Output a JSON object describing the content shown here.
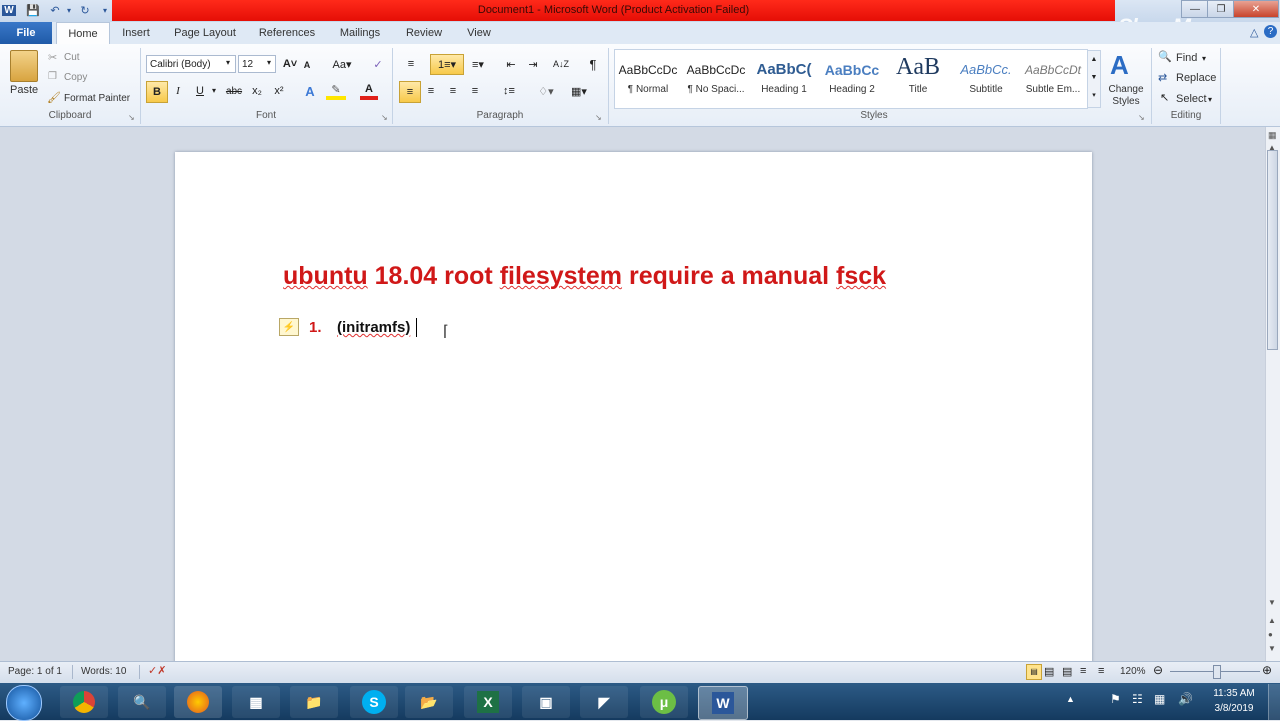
{
  "window": {
    "title": "Document1  -  Microsoft Word (Product Activation Failed)",
    "watermark": "ShowMore"
  },
  "tabs": [
    "File",
    "Home",
    "Insert",
    "Page Layout",
    "References",
    "Mailings",
    "Review",
    "View"
  ],
  "clipboard": {
    "paste": "Paste",
    "cut": "Cut",
    "copy": "Copy",
    "format_painter": "Format Painter",
    "group": "Clipboard"
  },
  "font": {
    "name": "Calibri (Body)",
    "size": "12",
    "group": "Font"
  },
  "paragraph": {
    "group": "Paragraph"
  },
  "styles": {
    "group": "Styles",
    "change_styles": "Change Styles",
    "items": [
      {
        "sample": "AaBbCcDc",
        "name": "¶ Normal"
      },
      {
        "sample": "AaBbCcDc",
        "name": "¶ No Spaci..."
      },
      {
        "sample": "AaBbC(",
        "name": "Heading 1"
      },
      {
        "sample": "AaBbCc",
        "name": "Heading 2"
      },
      {
        "sample": "AaB",
        "name": "Title"
      },
      {
        "sample": "AaBbCc.",
        "name": "Subtitle"
      },
      {
        "sample": "AaBbCcDt",
        "name": "Subtle Em..."
      }
    ]
  },
  "editing": {
    "group": "Editing",
    "find": "Find",
    "replace": "Replace",
    "select": "Select"
  },
  "document": {
    "title_words": [
      "ubuntu",
      "18.04",
      "root",
      "filesystem",
      "require",
      "a",
      "manual",
      "fsck"
    ],
    "list_number": "1.",
    "list_text": "(initramfs)"
  },
  "status": {
    "page": "Page: 1 of 1",
    "words": "Words: 10",
    "zoom": "120%"
  },
  "clock": {
    "time": "11:35 AM",
    "date": "3/8/2019"
  },
  "colors": {
    "title_bar_red": "#e50e06",
    "heading_red": "#d01818",
    "file_tab_blue": "#2b62b0"
  }
}
